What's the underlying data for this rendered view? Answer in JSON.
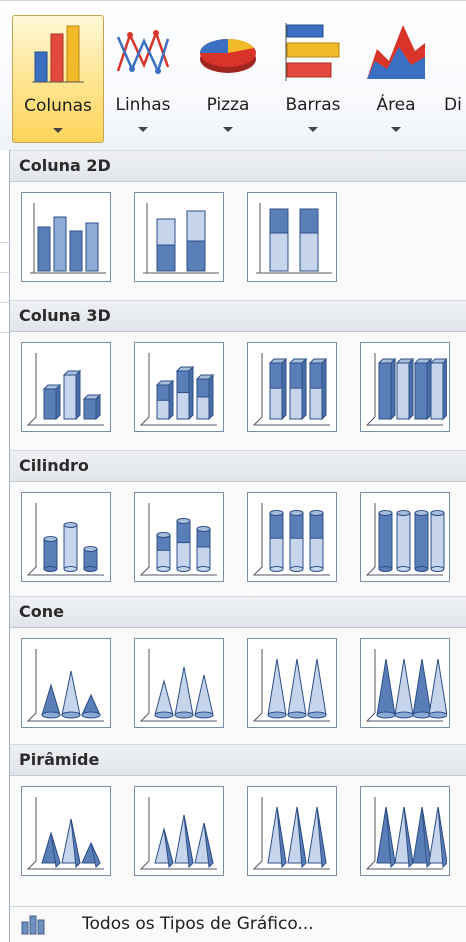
{
  "ribbon": {
    "buttons": [
      {
        "label": "Colunas",
        "icon": "column-chart-icon",
        "active": true
      },
      {
        "label": "Linhas",
        "icon": "line-chart-icon"
      },
      {
        "label": "Pizza",
        "icon": "pie-chart-icon"
      },
      {
        "label": "Barras",
        "icon": "bar-chart-icon"
      },
      {
        "label": "Área",
        "icon": "area-chart-icon"
      },
      {
        "label": "Di",
        "icon": "scatter-chart-icon"
      }
    ]
  },
  "gallery": {
    "sections": [
      {
        "title": "Coluna 2D",
        "items": [
          "clustered-column-2d",
          "stacked-column-2d",
          "100-stacked-column-2d"
        ]
      },
      {
        "title": "Coluna 3D",
        "items": [
          "clustered-column-3d",
          "stacked-column-3d",
          "100-stacked-column-3d",
          "column-3d"
        ]
      },
      {
        "title": "Cilindro",
        "items": [
          "clustered-cylinder",
          "stacked-cylinder",
          "100-stacked-cylinder",
          "cylinder-3d"
        ]
      },
      {
        "title": "Cone",
        "items": [
          "clustered-cone",
          "stacked-cone",
          "100-stacked-cone",
          "cone-3d"
        ]
      },
      {
        "title": "Pirâmide",
        "items": [
          "clustered-pyramid",
          "stacked-pyramid",
          "100-stacked-pyramid",
          "pyramid-3d"
        ]
      }
    ],
    "footer": {
      "label": "Todos os Tipos de Gráfico...",
      "icon": "all-chart-types-icon"
    }
  }
}
